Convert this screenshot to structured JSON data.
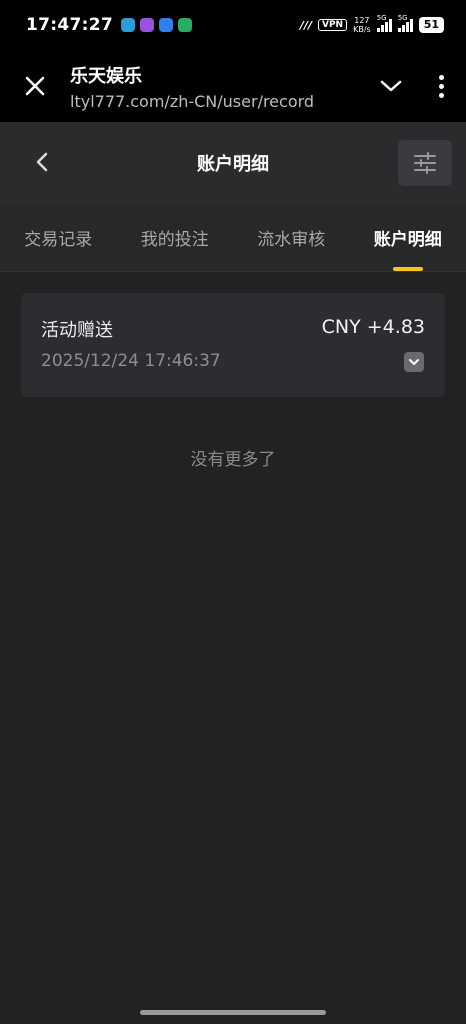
{
  "status_bar": {
    "time": "17:47:27",
    "vpn": "VPN",
    "speed_value": "127",
    "speed_unit": "KB/s",
    "network_1": "5G",
    "network_2": "5G",
    "battery": "51"
  },
  "browser": {
    "title": "乐天娱乐",
    "url": "ltyl777.com/zh-CN/user/record"
  },
  "header": {
    "title": "账户明细"
  },
  "tabs": [
    {
      "label": "交易记录",
      "active": false
    },
    {
      "label": "我的投注",
      "active": false
    },
    {
      "label": "流水审核",
      "active": false
    },
    {
      "label": "账户明细",
      "active": true
    }
  ],
  "records": [
    {
      "type": "活动赠送",
      "amount": "CNY +4.83",
      "time": "2025/12/24 17:46:37"
    }
  ],
  "list": {
    "end_text": "没有更多了"
  },
  "colors": {
    "background": "#222222",
    "card": "#2c2d30",
    "accent": "#f5c518"
  }
}
